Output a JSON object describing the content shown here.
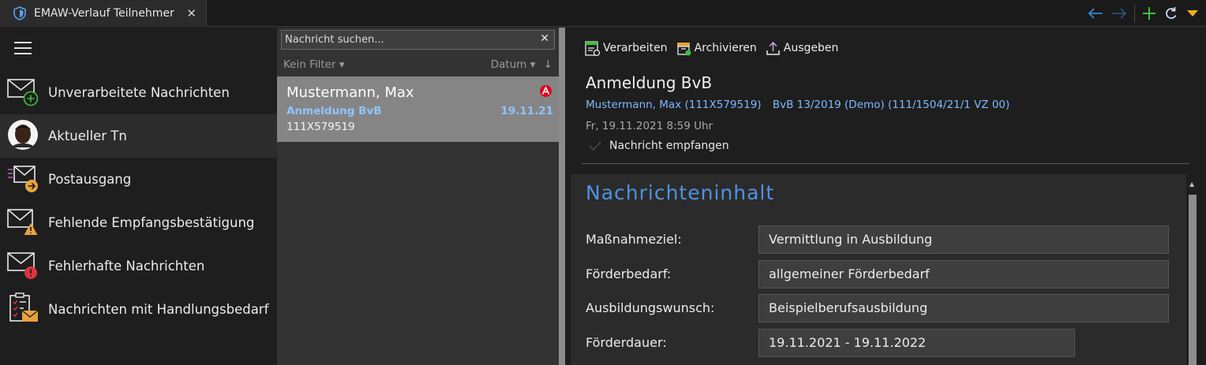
{
  "window": {
    "tab_title": "EMAW-Verlauf Teilnehmer",
    "close_glyph": "✕",
    "tab_icon": "shield-icon",
    "tools": [
      "arrow-left-icon",
      "arrow-right-icon",
      "plus-icon",
      "refresh-icon",
      "triangle-down-icon"
    ]
  },
  "sidebar": {
    "menu_icon": "hamburger-icon",
    "items": [
      {
        "label": "Unverarbeitete Nachrichten",
        "icon": "mail-add-icon",
        "active": false
      },
      {
        "label": "Aktueller Tn",
        "icon": "avatar",
        "active": true
      },
      {
        "label": "Postausgang",
        "icon": "mail-outgoing-icon",
        "active": false
      },
      {
        "label": "Fehlende Empfangsbestätigung",
        "icon": "mail-warning-icon",
        "active": false
      },
      {
        "label": "Fehlerhafte Nachrichten",
        "icon": "mail-error-icon",
        "active": false
      },
      {
        "label": "Nachrichten mit Handlungsbedarf",
        "icon": "clipboard-mail-icon",
        "active": false
      }
    ]
  },
  "list": {
    "search": {
      "placeholder": "Nachricht suchen...",
      "value": "",
      "clear_glyph": "✕"
    },
    "filter": {
      "label": "Kein Filter ▾",
      "sort_label": "Datum ▾",
      "sort_arrow": "↓"
    },
    "messages": [
      {
        "name": "Mustermann, Max",
        "subject": "Anmeldung BvB",
        "date": "19.11.21",
        "id": "111X579519",
        "selected": true
      }
    ]
  },
  "detail": {
    "toolbar": {
      "process_label": "Verarbeiten",
      "archive_label": "Archivieren",
      "export_label": "Ausgeben"
    },
    "subject": "Anmeldung BvB",
    "participant": "Mustermann, Max (111X579519)",
    "course": "BvB 13/2019 (Demo) (111/1504/21/1 VZ 00)",
    "datetime": "Fr, 19.11.2021 8:59 Uhr",
    "status": "Nachricht empfangen",
    "content": {
      "title": "Nachrichteninhalt",
      "fields": [
        {
          "label": "Maßnahmeziel:",
          "value": "Vermittlung in Ausbildung"
        },
        {
          "label": "Förderbedarf:",
          "value": "allgemeiner Förderbedarf"
        },
        {
          "label": "Ausbildungswunsch:",
          "value": "Beispielberufsausbildung"
        },
        {
          "label": "Förderdauer:",
          "value": "19.11.2021 - 19.11.2022"
        }
      ]
    }
  },
  "colors": {
    "accent_blue": "#4f92e2",
    "link_blue": "#7fb8ff",
    "green": "#3fbf3f",
    "orange": "#e8a33a",
    "red": "#d9363e"
  }
}
